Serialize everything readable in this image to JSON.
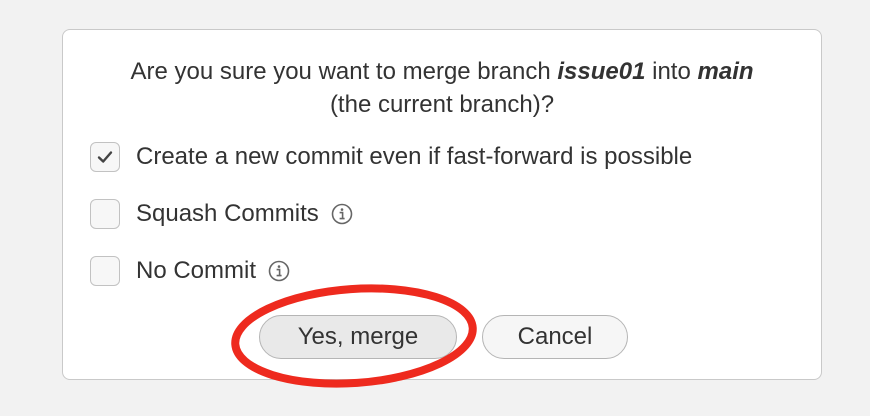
{
  "dialog": {
    "prompt_prefix": "Are you sure you want to merge branch",
    "source_branch": "issue01",
    "prompt_into": "into",
    "target_branch": "main",
    "prompt_suffix": "(the current branch)?"
  },
  "options": [
    {
      "label": "Create a new commit even if fast-forward is possible",
      "checked": true,
      "has_info": false
    },
    {
      "label": "Squash Commits",
      "checked": false,
      "has_info": true
    },
    {
      "label": "No Commit",
      "checked": false,
      "has_info": true
    }
  ],
  "buttons": {
    "confirm_label": "Yes, merge",
    "cancel_label": "Cancel"
  },
  "colors": {
    "annotation": "#ee2a1e",
    "background": "#f2f2f2",
    "dialog": "#ffffff"
  },
  "icons": {
    "info": "info-circle-icon",
    "check": "checkmark-icon"
  }
}
